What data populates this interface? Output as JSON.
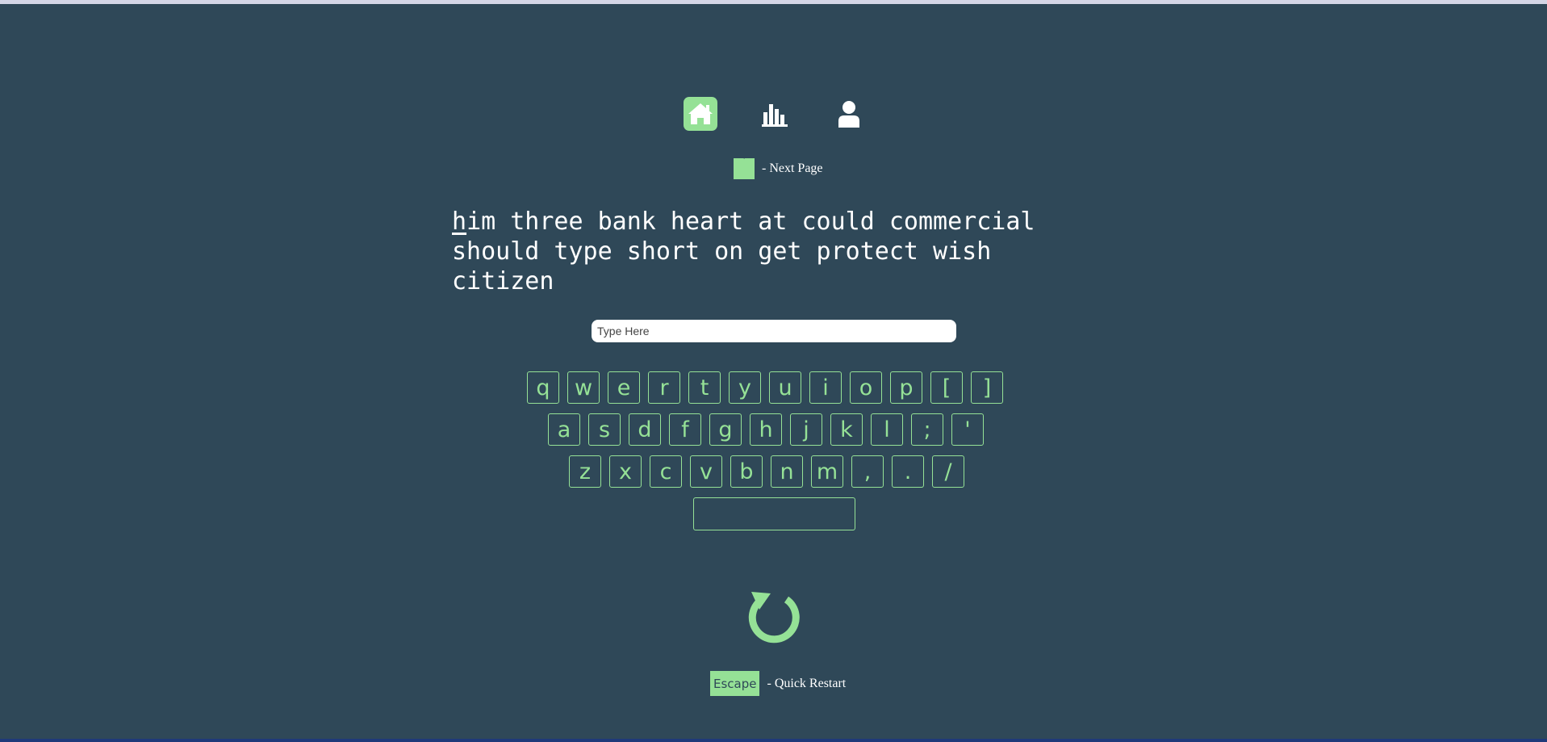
{
  "colors": {
    "background": "#2f4858",
    "accent": "#95e196",
    "text": "#ffffff"
  },
  "nav": {
    "items": [
      {
        "icon": "home-icon",
        "active": true
      },
      {
        "icon": "bar-chart-icon",
        "active": false
      },
      {
        "icon": "user-icon",
        "active": false
      }
    ]
  },
  "next_page_hint": {
    "key": "`",
    "text": "- Next Page"
  },
  "passage": {
    "current_char": "h",
    "rest": "im three bank heart at could commercial should type short on get protect wish citizen"
  },
  "input": {
    "placeholder": "Type Here",
    "value": ""
  },
  "keyboard": {
    "row1": [
      "q",
      "w",
      "e",
      "r",
      "t",
      "y",
      "u",
      "i",
      "o",
      "p",
      "[",
      "]"
    ],
    "row2": [
      "a",
      "s",
      "d",
      "f",
      "g",
      "h",
      "j",
      "k",
      "l",
      ";",
      "'"
    ],
    "row3": [
      "z",
      "x",
      "c",
      "v",
      "b",
      "n",
      "m",
      ",",
      ".",
      "/"
    ]
  },
  "restart": {
    "icon": "restart-icon"
  },
  "escape_hint": {
    "key": "Escape",
    "text": "- Quick Restart"
  }
}
